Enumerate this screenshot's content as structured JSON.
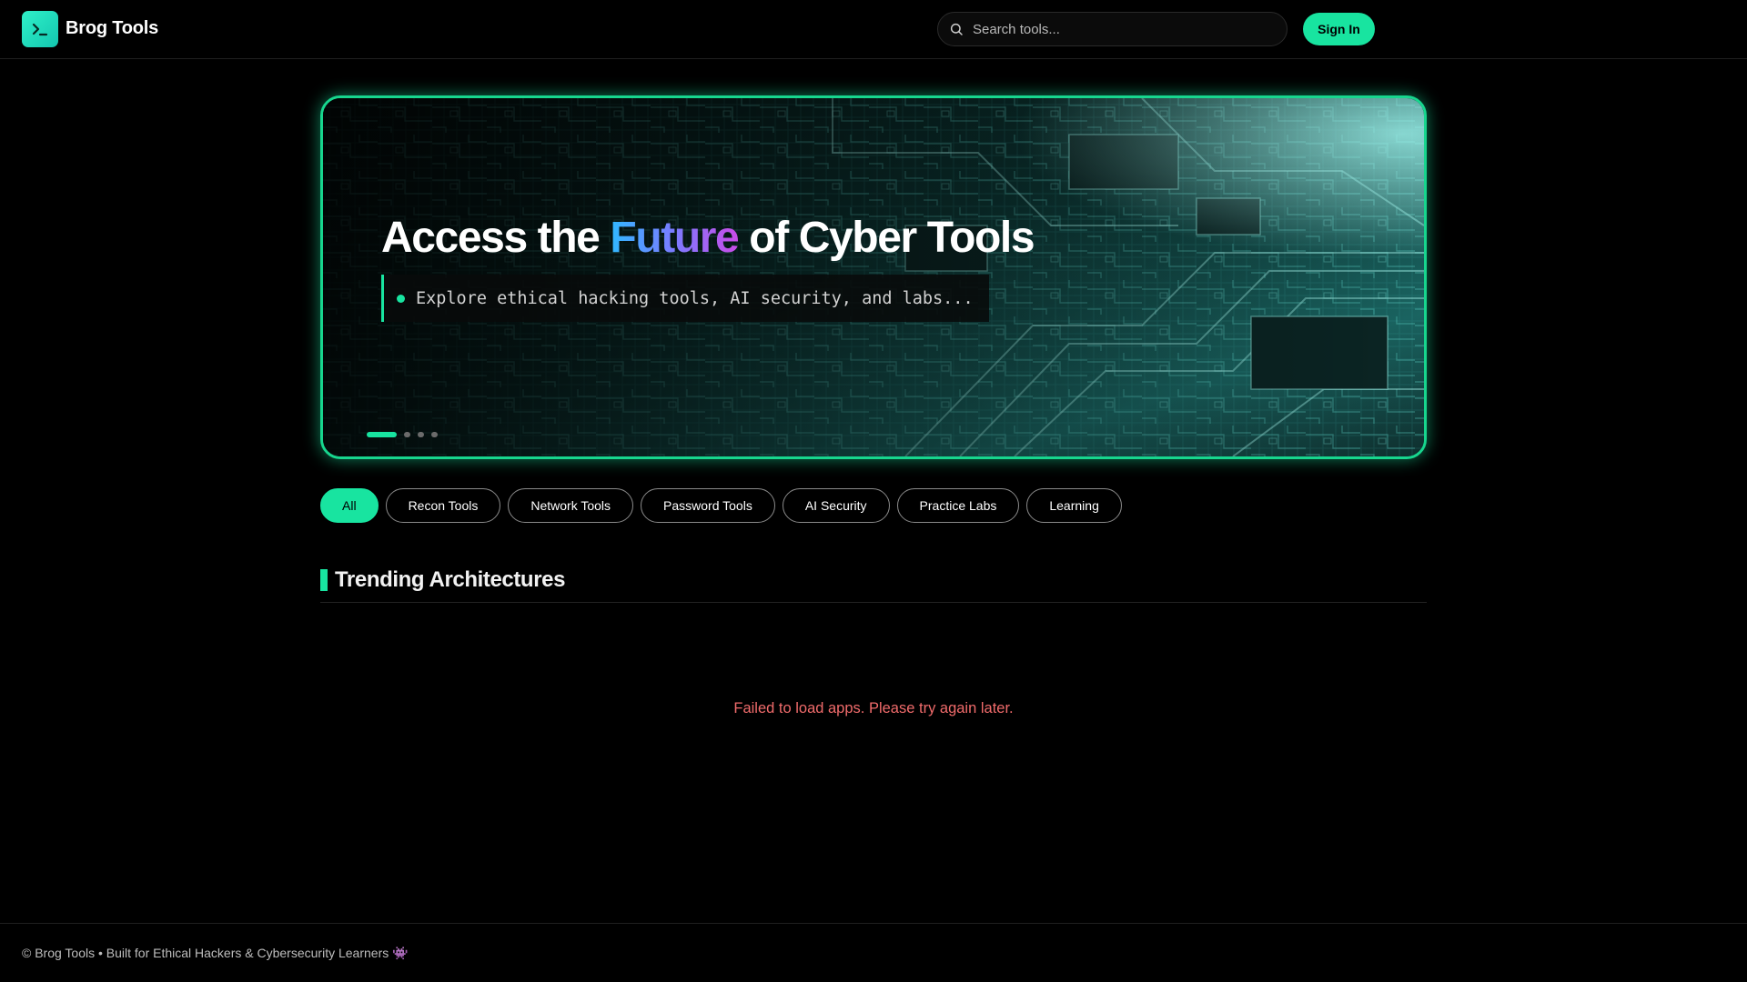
{
  "header": {
    "brand": "Brog Tools",
    "logo_icon": "terminal-prompt-icon",
    "search_placeholder": "Search tools...",
    "signin_label": "Sign In"
  },
  "hero": {
    "title_before": "Access the ",
    "title_accent": "Future",
    "title_after": " of Cyber Tools",
    "subtitle": "Explore ethical hacking tools, AI security, and labs...",
    "slide_count": 4,
    "active_slide": 1
  },
  "filters": [
    {
      "label": "All",
      "active": true
    },
    {
      "label": "Recon Tools",
      "active": false
    },
    {
      "label": "Network Tools",
      "active": false
    },
    {
      "label": "Password Tools",
      "active": false
    },
    {
      "label": "AI Security",
      "active": false
    },
    {
      "label": "Practice Labs",
      "active": false
    },
    {
      "label": "Learning",
      "active": false
    }
  ],
  "section": {
    "title": "Trending Architectures",
    "error_message": "Failed to load apps. Please try again later."
  },
  "footer": {
    "text": "© Brog Tools • Built for Ethical Hackers & Cybersecurity Learners 👾"
  },
  "colors": {
    "accent": "#18e4a0",
    "error": "#f06b6b",
    "background": "#000000"
  }
}
